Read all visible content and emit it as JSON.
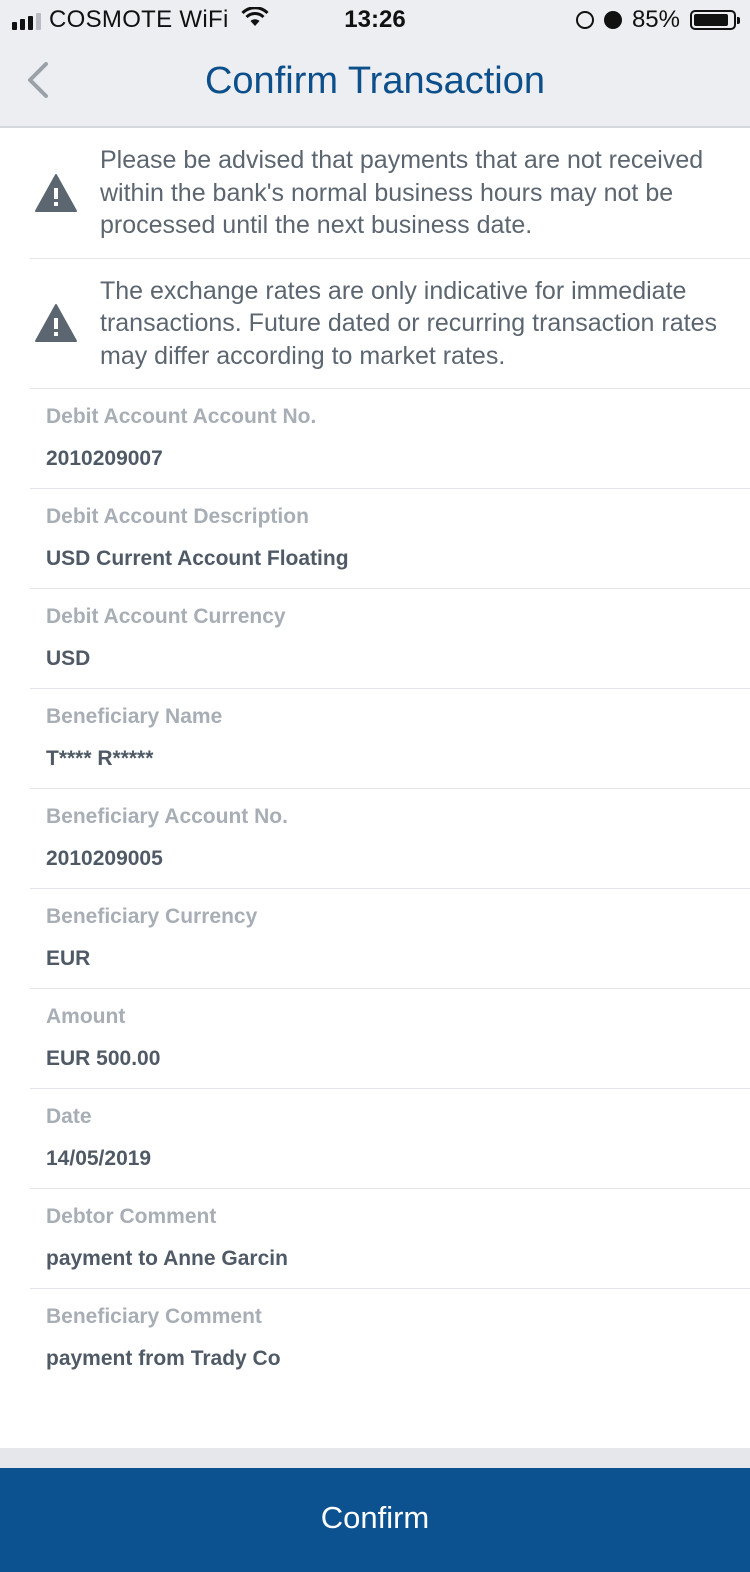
{
  "status_bar": {
    "carrier": "COSMOTE WiFi",
    "time": "13:26",
    "battery_percent": "85%"
  },
  "nav": {
    "title": "Confirm Transaction"
  },
  "notices": [
    "Please be advised that payments that are not received within the bank's normal business hours may not be processed until the next business date.",
    "The exchange rates are only indicative for immediate transactions. Future dated or recurring transaction rates may differ according to market rates."
  ],
  "fields": [
    {
      "label": "Debit Account Account No.",
      "value": "2010209007"
    },
    {
      "label": "Debit Account Description",
      "value": "USD Current Account Floating"
    },
    {
      "label": "Debit Account Currency",
      "value": "USD"
    },
    {
      "label": "Beneficiary Name",
      "value": "T**** R*****"
    },
    {
      "label": "Beneficiary Account No.",
      "value": "2010209005"
    },
    {
      "label": "Beneficiary Currency",
      "value": "EUR"
    },
    {
      "label": "Amount",
      "value": "EUR 500.00"
    },
    {
      "label": "Date",
      "value": "14/05/2019"
    },
    {
      "label": "Debtor Comment",
      "value": "payment to Anne Garcin"
    },
    {
      "label": "Beneficiary Comment",
      "value": "payment from Trady Co"
    }
  ],
  "confirm_label": "Confirm",
  "colors": {
    "accent": "#0d5290",
    "title": "#0d4f8b",
    "label": "#a8aeb5",
    "value": "#4f5a66"
  }
}
